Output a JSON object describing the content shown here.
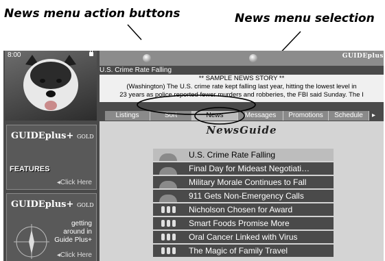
{
  "annotations": {
    "action_buttons": "News menu action buttons",
    "menu_selection": "News menu selection"
  },
  "status": {
    "time": "8:00"
  },
  "headline": "U.S. Crime Rate Falling",
  "story": [
    "** SAMPLE NEWS STORY **",
    "(Washington)  The U.S. crime rate kept falling last year, hitting the lowest level in",
    "23 years as police reported fewer murders and robberies, the FBI said Sunday. The I"
  ],
  "menu": {
    "items": [
      "Listings",
      "Sort",
      "News",
      "Messages",
      "Promotions",
      "Schedule"
    ],
    "selected": "News"
  },
  "guide": {
    "title": "NewsGuide",
    "items": [
      {
        "label": "U.S. Crime Rate Falling",
        "icon": "globe-icon",
        "selected": true
      },
      {
        "label": "Final Day for Mideast Negotiati…",
        "icon": "globe-icon"
      },
      {
        "label": "Military Morale Continues to Fall",
        "icon": "globe-icon"
      },
      {
        "label": "911 Gets Non-Emergency Calls",
        "icon": "globe-icon"
      },
      {
        "label": "Nicholson Chosen for Award",
        "icon": "people-icon"
      },
      {
        "label": "Smart Foods Promise More",
        "icon": "people-icon"
      },
      {
        "label": "Oral Cancer Linked with Virus",
        "icon": "people-icon"
      },
      {
        "label": "The Magic of Family Travel",
        "icon": "people-icon"
      }
    ]
  },
  "promos": {
    "logo": "GUIDEplus+",
    "logo_sub": "GOLD",
    "features_label": "FEATURES",
    "features_click": "◂Click Here",
    "help_text": [
      "getting",
      "around in",
      "Guide Plus+"
    ],
    "help_click": "◂Click Here"
  },
  "brand": "GUIDEplus"
}
